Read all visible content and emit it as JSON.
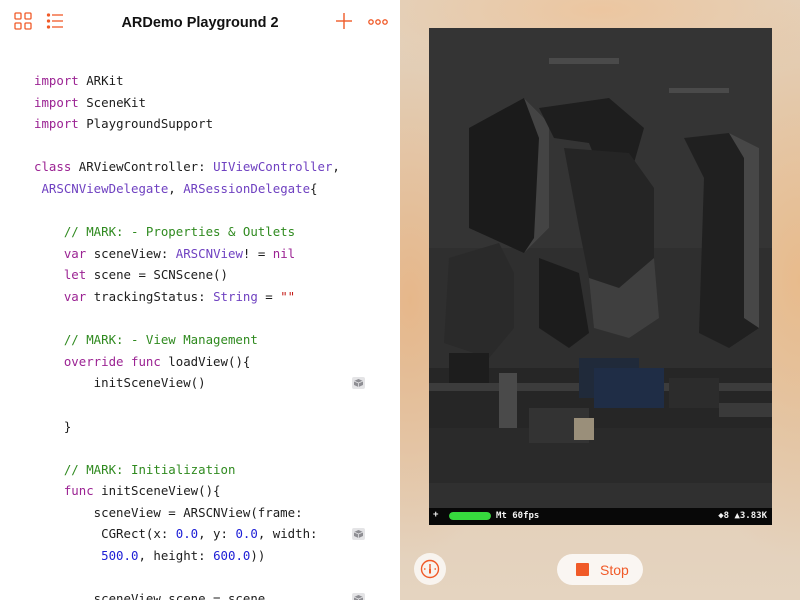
{
  "app": {
    "title": "ARDemo Playground 2",
    "accent_color": "#f05a28"
  },
  "toolbar": {
    "left_icons": [
      "grid-icon",
      "list-icon"
    ],
    "right_icons": [
      "plus-icon",
      "more-icon"
    ]
  },
  "code_lines": [
    [
      {
        "t": "import",
        "c": "kw"
      },
      {
        "t": " ARKit"
      }
    ],
    [
      {
        "t": "import",
        "c": "kw"
      },
      {
        "t": " SceneKit"
      }
    ],
    [
      {
        "t": "import",
        "c": "kw"
      },
      {
        "t": " PlaygroundSupport"
      }
    ],
    [],
    [
      {
        "t": "class",
        "c": "kw"
      },
      {
        "t": " ARViewController: "
      },
      {
        "t": "UIViewController",
        "c": "type"
      },
      {
        "t": ","
      }
    ],
    [
      {
        "t": " "
      },
      {
        "t": "ARSCNViewDelegate",
        "c": "type"
      },
      {
        "t": ", "
      },
      {
        "t": "ARSessionDelegate",
        "c": "type"
      },
      {
        "t": "{"
      }
    ],
    [],
    [
      {
        "t": "    "
      },
      {
        "t": "// MARK: - Properties & Outlets",
        "c": "cmt"
      }
    ],
    [
      {
        "t": "    "
      },
      {
        "t": "var",
        "c": "kw"
      },
      {
        "t": " sceneView: "
      },
      {
        "t": "ARSCNView",
        "c": "type"
      },
      {
        "t": "! = "
      },
      {
        "t": "nil",
        "c": "kw"
      }
    ],
    [
      {
        "t": "    "
      },
      {
        "t": "let",
        "c": "kw"
      },
      {
        "t": " scene = SCNScene()"
      }
    ],
    [
      {
        "t": "    "
      },
      {
        "t": "var",
        "c": "kw"
      },
      {
        "t": " trackingStatus: "
      },
      {
        "t": "String",
        "c": "type"
      },
      {
        "t": " = "
      },
      {
        "t": "\"\"",
        "c": "str"
      }
    ],
    [],
    [
      {
        "t": "    "
      },
      {
        "t": "// MARK: - View Management",
        "c": "cmt"
      }
    ],
    [
      {
        "t": "    "
      },
      {
        "t": "override",
        "c": "kw"
      },
      {
        "t": " "
      },
      {
        "t": "func",
        "c": "kw"
      },
      {
        "t": " loadView(){"
      }
    ],
    [
      {
        "t": "        initSceneView()"
      }
    ],
    [],
    [
      {
        "t": "    }"
      }
    ],
    [],
    [
      {
        "t": "    "
      },
      {
        "t": "// MARK: Initialization",
        "c": "cmt"
      }
    ],
    [
      {
        "t": "    "
      },
      {
        "t": "func",
        "c": "kw"
      },
      {
        "t": " initSceneView(){"
      }
    ],
    [
      {
        "t": "        sceneView = ARSCNView(frame:"
      }
    ],
    [
      {
        "t": "         CGRect(x: "
      },
      {
        "t": "0.0",
        "c": "num"
      },
      {
        "t": ", y: "
      },
      {
        "t": "0.0",
        "c": "num"
      },
      {
        "t": ", width:"
      }
    ],
    [
      {
        "t": "         "
      },
      {
        "t": "500.0",
        "c": "num"
      },
      {
        "t": ", height: "
      },
      {
        "t": "600.0",
        "c": "num"
      },
      {
        "t": "))"
      }
    ],
    [],
    [
      {
        "t": "        sceneView.scene = scene"
      }
    ]
  ],
  "code_badges": [
    14,
    21,
    24
  ],
  "live_view": {
    "stats": {
      "plus": "+",
      "fps_label": "Mt 60fps",
      "fps_level": 1.0,
      "counts": "◆8 ▲3.83K"
    },
    "stop_label": "Stop",
    "gauge_icon": "speedometer-icon"
  }
}
